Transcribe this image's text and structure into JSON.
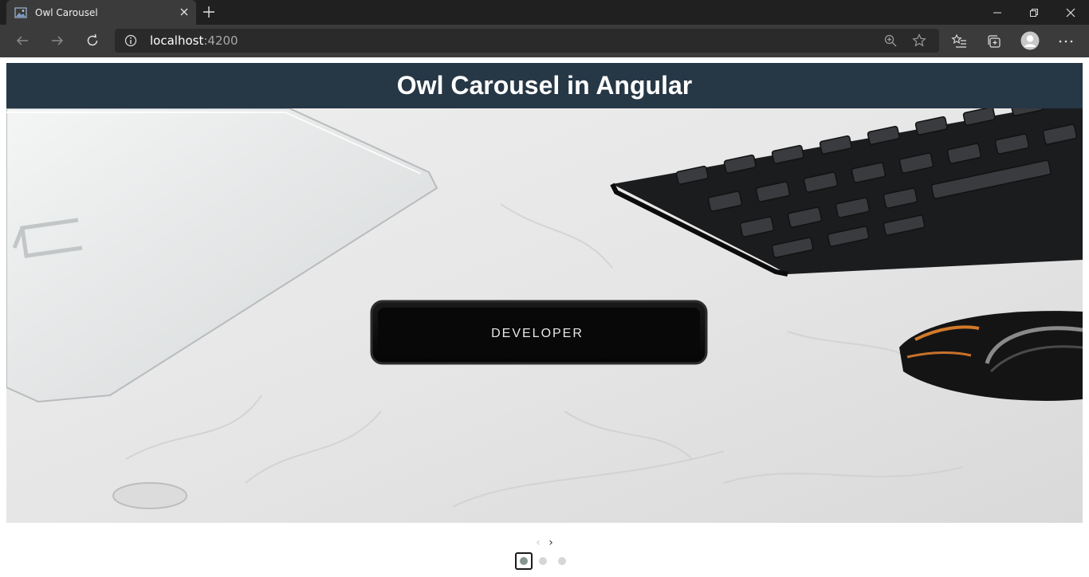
{
  "browser": {
    "tab_title": "Owl Carousel",
    "url_host": "localhost",
    "url_port": ":4200"
  },
  "page": {
    "title": "Owl Carousel in Angular"
  },
  "carousel": {
    "slide_image": "photo of white laptop, black keyboard, smartphone and mouse on a white bedsheet",
    "phone_text": "DEVELOPER",
    "prev_label": "‹",
    "next_label": "›",
    "dots": [
      {
        "active": true
      },
      {
        "active": false
      },
      {
        "active": false
      }
    ]
  },
  "colors": {
    "header_bg": "#263746",
    "active_dot": "#869791",
    "inactive_dot": "#d6d6d6"
  }
}
